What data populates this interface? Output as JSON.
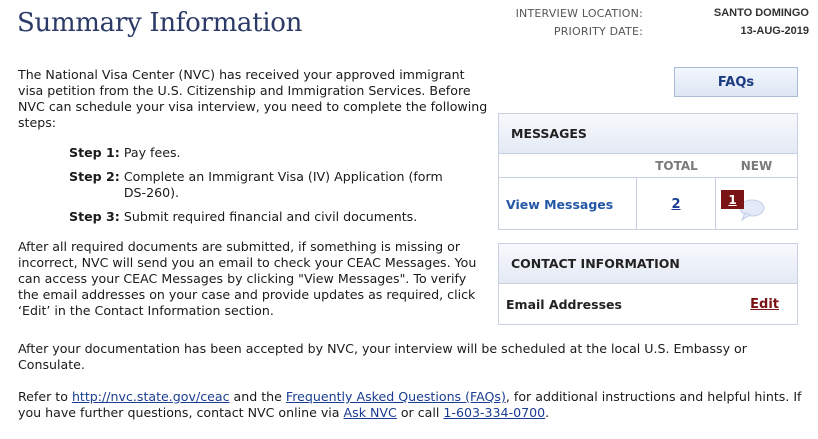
{
  "header": {
    "title": "Summary Information",
    "interview_location_label": "INTERVIEW LOCATION:",
    "interview_location_value": "SANTO DOMINGO",
    "priority_date_label": "PRIORITY DATE:",
    "priority_date_value": "13-AUG-2019"
  },
  "main": {
    "intro": "The National Visa Center (NVC) has received your approved immigrant visa petition from the U.S. Citizenship and Immigration Services. Before NVC can schedule your visa interview, you need to complete the following steps:",
    "steps": [
      {
        "label": "Step 1:",
        "text": "Pay fees."
      },
      {
        "label": "Step 2:",
        "text": "Complete an Immigrant Visa (IV) Application (form DS-260)."
      },
      {
        "label": "Step 3:",
        "text": "Submit required financial and civil documents."
      }
    ],
    "after_docs": "After all required documents are submitted, if something is missing or incorrect, NVC will send you an email to check your CEAC Messages. You can access your CEAC Messages by clicking \"View Messages\". To verify the email addresses on your case and provide updates as required, click ‘Edit’ in the Contact Information section.",
    "accepted": "After your documentation has been accepted by NVC, your interview will be scheduled at the local U.S. Embassy or Consulate.",
    "refer_prefix": "Refer to ",
    "ceac_link": "http://nvc.state.gov/ceac",
    "refer_mid": " and the ",
    "faq_link": "Frequently Asked Questions (FAQs)",
    "refer_after_faq": ", for additional instructions and helpful hints. If you have further questions, contact NVC online via ",
    "ask_nvc_link": "Ask NVC",
    "refer_or_call": " or call ",
    "phone_link": "1-603-334-0700",
    "refer_end": "."
  },
  "faq_button": {
    "label": "FAQs"
  },
  "messages": {
    "title": "MESSAGES",
    "col_total": "TOTAL",
    "col_new": "NEW",
    "row_label": "View Messages",
    "total": "2",
    "new": "1",
    "new_icon": "speech-bubble-icon"
  },
  "contact": {
    "title": "CONTACT INFORMATION",
    "row_label": "Email Addresses",
    "edit_label": "Edit"
  },
  "colors": {
    "title": "#2b3a66",
    "link": "#1a3d91",
    "accent_dark_red": "#7a1414",
    "box_border": "#c8d1e3"
  }
}
